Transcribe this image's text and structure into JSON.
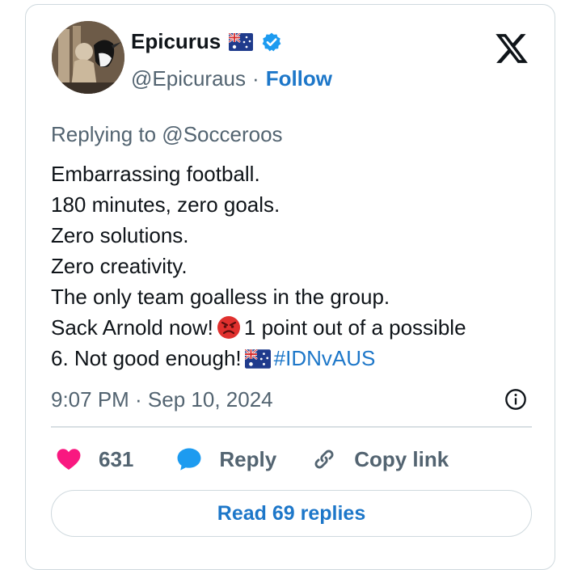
{
  "author": {
    "display_name": "Epicurus",
    "handle": "@Epicuraus",
    "separator": "·",
    "follow_label": "Follow"
  },
  "tweet": {
    "replying_to": "Replying to @Socceroos",
    "lines": [
      "Embarrassing football.",
      "180 minutes, zero goals.",
      "Zero solutions.",
      "Zero creativity.",
      "The only team goalless in the group."
    ],
    "line6_a": "Sack Arnold now!",
    "line6_b": "1 point out of a possible",
    "line7_a": "6. Not good enough!",
    "hashtag": "#IDNvAUS",
    "timestamp": "9:07 PM · Sep 10, 2024"
  },
  "actions": {
    "like_count": "631",
    "reply_label": "Reply",
    "copy_label": "Copy link"
  },
  "read_replies_label": "Read 69 replies",
  "colors": {
    "link": "#1d77c9",
    "heart": "#f91880",
    "reply_bubble": "#1d9bf0",
    "secondary_text": "#536471",
    "verified": "#1d9bf0"
  },
  "icons": {
    "logo": "x-logo-icon",
    "verified": "verified-badge-icon",
    "flag": "australia-flag-icon",
    "emoji": "angry-face-emoji-icon",
    "info": "info-icon",
    "like": "heart-icon",
    "reply": "reply-bubble-icon",
    "copy": "link-icon"
  }
}
